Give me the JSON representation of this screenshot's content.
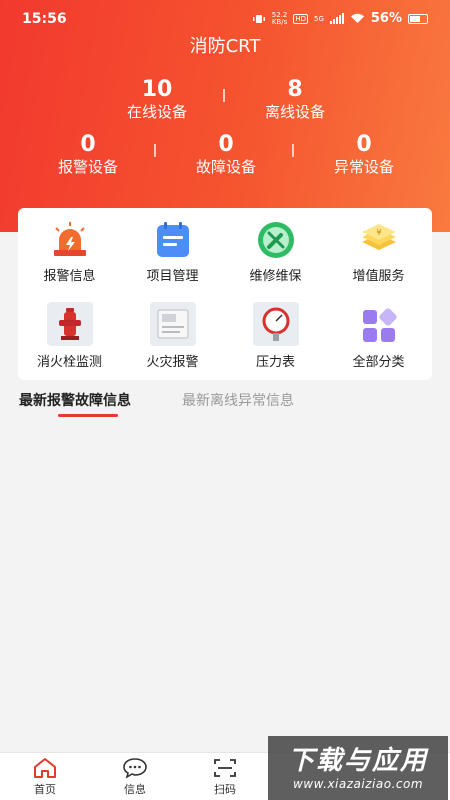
{
  "status_bar": {
    "time": "15:56",
    "speed_value": "52.2",
    "speed_unit": "KB/s",
    "hd": "HD",
    "network": "5G",
    "battery": "56%"
  },
  "app": {
    "title": "消防CRT"
  },
  "stats": [
    {
      "value": "10",
      "label": "在线设备"
    },
    {
      "value": "8",
      "label": "离线设备"
    },
    {
      "value": "0",
      "label": "报警设备"
    },
    {
      "value": "0",
      "label": "故障设备"
    },
    {
      "value": "0",
      "label": "异常设备"
    }
  ],
  "menu": [
    {
      "label": "报警信息",
      "icon": "alarm-siren-icon"
    },
    {
      "label": "项目管理",
      "icon": "calendar-list-icon"
    },
    {
      "label": "维修维保",
      "icon": "wrench-icon"
    },
    {
      "label": "增值服务",
      "icon": "yuan-stack-icon"
    },
    {
      "label": "消火栓监测",
      "icon": "fire-hydrant-icon"
    },
    {
      "label": "火灾报警",
      "icon": "fire-alarm-panel-icon"
    },
    {
      "label": "压力表",
      "icon": "pressure-gauge-icon"
    },
    {
      "label": "全部分类",
      "icon": "grid-categories-icon"
    }
  ],
  "tabs": [
    {
      "label": "最新报警故障信息",
      "active": true
    },
    {
      "label": "最新离线异常信息",
      "active": false
    }
  ],
  "bottom_nav": [
    {
      "label": "首页",
      "icon": "home-icon"
    },
    {
      "label": "信息",
      "icon": "chat-icon"
    },
    {
      "label": "扫码",
      "icon": "scan-icon"
    }
  ],
  "watermark": {
    "title": "下载与应用",
    "url": "www.xiazaiziao.com"
  },
  "colors": {
    "header_start": "#f2392e",
    "header_end": "#f97a3f",
    "accent": "#e53a2e"
  }
}
